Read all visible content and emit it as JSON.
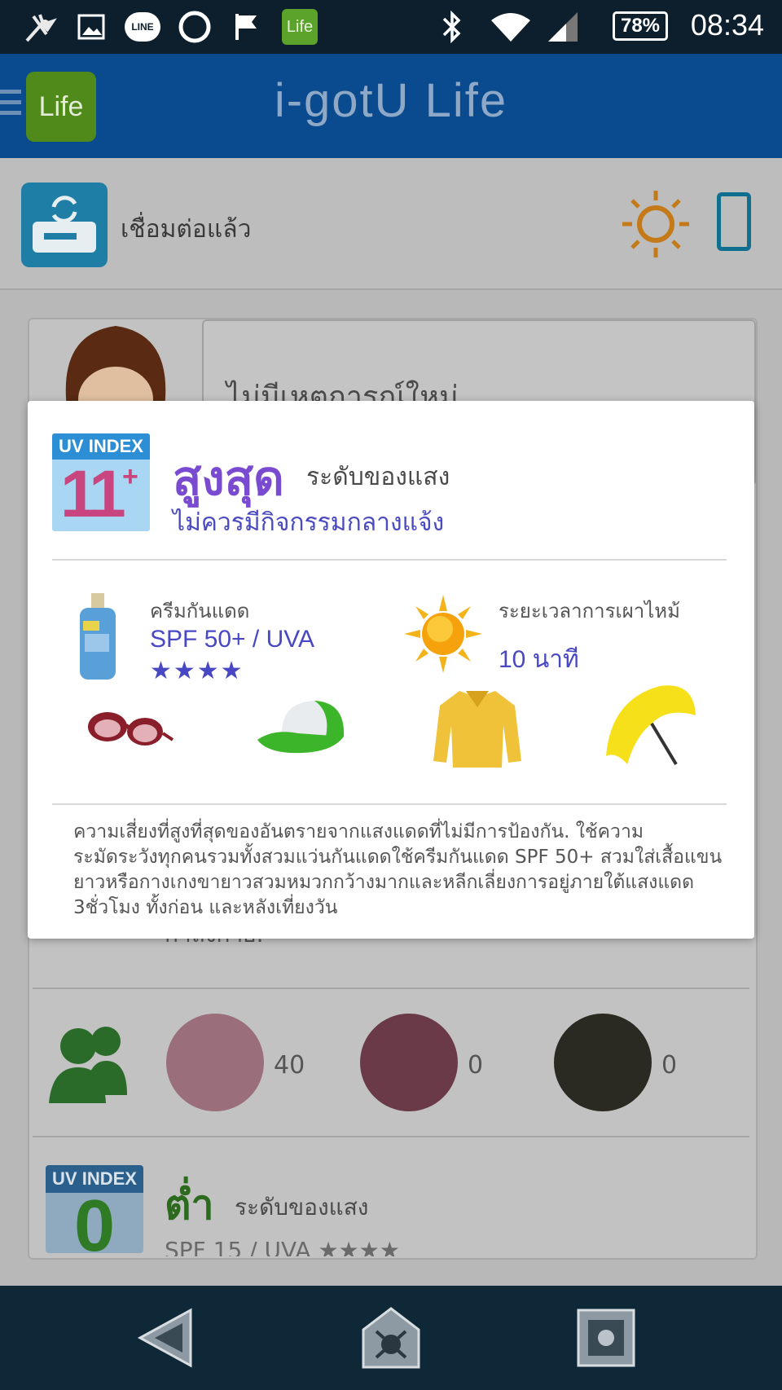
{
  "status_bar": {
    "time": "08:34",
    "battery": "78%",
    "icons": [
      "bug-icon",
      "image-icon",
      "line-icon",
      "circle-icon",
      "flag-icon",
      "life-app-icon",
      "bluetooth-icon",
      "wifi-icon",
      "signal-icon"
    ],
    "line_label": "LINE",
    "life_label": "Life"
  },
  "app_bar": {
    "title": "i-gotU Life",
    "logo_label": "Life"
  },
  "connection": {
    "status": "เชื่อมต่อแล้ว"
  },
  "background": {
    "message": "ไม่มีเหตุการณ์ใหม่",
    "tip_line": "กำลังกาย.",
    "friend_counts": [
      "40",
      "0",
      "0"
    ],
    "uv_low": {
      "badge_label": "UV INDEX",
      "index": "0",
      "level": "ต่ำ",
      "level_sub": "ระดับของแสง",
      "spf": "SPF 15 / UVA ★★★★"
    }
  },
  "dialog": {
    "badge_label": "UV INDEX",
    "uv_index": "11",
    "uv_plus": "+",
    "level": "สูงสุด",
    "level_sub": "ระดับของแสง",
    "advice": "ไม่ควรมีกิจกรรมกลางแจ้ง",
    "sunscreen_label": "ครีมกันแดด",
    "sunscreen_value": "SPF 50+ / UVA",
    "sunscreen_stars": "★★★★",
    "burn_label": "ระยะเวลาการเผาไหม้",
    "burn_value": "10 นาที",
    "protection_items": [
      "sunglasses-icon",
      "cap-icon",
      "long-sleeve-shirt-icon",
      "umbrella-icon"
    ],
    "warning": "ความเสี่ยงที่สูงที่สุดของอันตรายจากแสงแดดที่ไม่มีการป้องกัน. ใช้ความระมัดระวังทุกคนรวมทั้งสวมแว่นกันแดดใช้ครีมกันแดด SPF 50+ สวมใส่เสื้อแขนยาวหรือกางเกงขายาวสวมหมวกกว้างมากและหลีกเลี่ยงการอยู่ภายใต้แสงแดด 3ชั่วโมง ทั้งก่อน และหลังเที่ยงวัน"
  },
  "colors": {
    "app_bar": "#0a4a8e",
    "status_bar": "#0d1f2c",
    "level_high": "#7a4bd1",
    "value_blue": "#4848c4",
    "level_low": "#2c6a1e"
  }
}
